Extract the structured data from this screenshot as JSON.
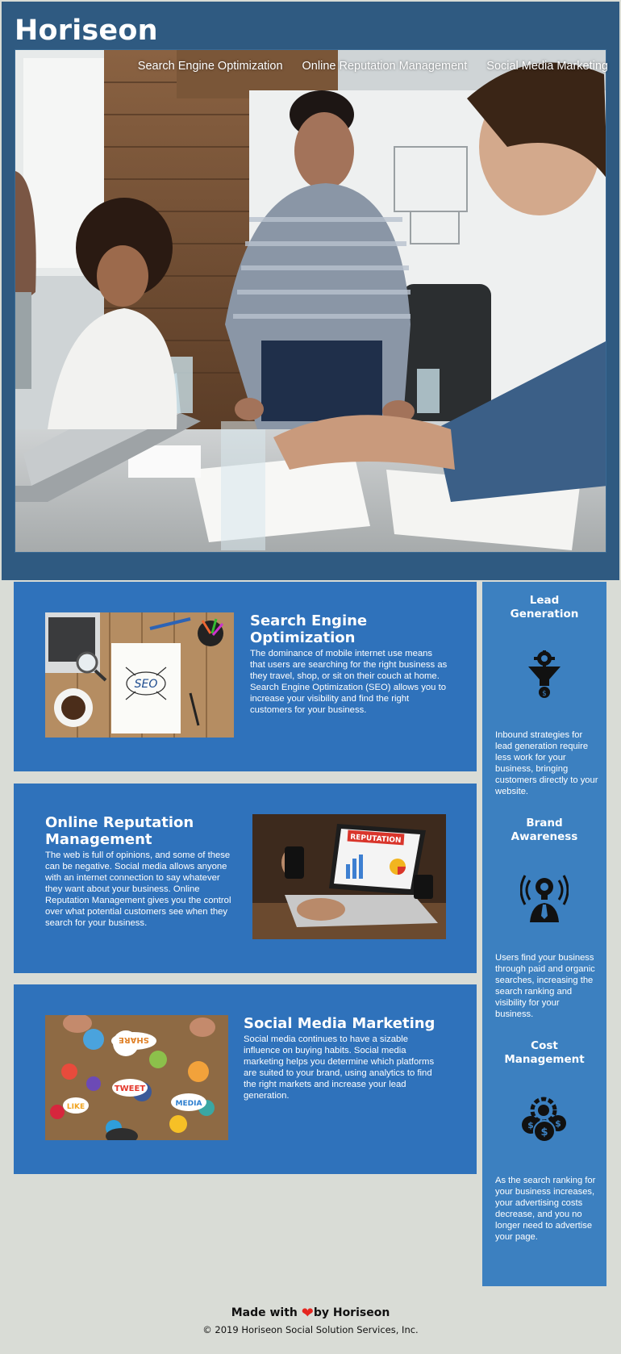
{
  "header": {
    "brand": "Horiseon",
    "nav": [
      {
        "label": "Search Engine Optimization"
      },
      {
        "label": "Online Reputation Management"
      },
      {
        "label": "Social Media Marketing"
      }
    ]
  },
  "hero": {
    "image": "team-meeting-photo"
  },
  "sections": [
    {
      "title": "Search Engine Optimization",
      "body": "The dominance of mobile internet use means that users are searching for the right business as they travel, shop, or sit on their couch at home. Search Engine Optimization (SEO) allows you to increase your visibility and find the right customers for your business.",
      "image": "seo-notebook-photo",
      "image_text": "SEO"
    },
    {
      "title": "Online Reputation Management",
      "body": "The web is full of opinions, and some of these can be negative. Social media allows anyone with an internet connection to say whatever they want about your business. Online Reputation Management gives you the control over what potential customers see when they search for your business.",
      "image": "laptop-reputation-photo",
      "image_text": "REPUTATION"
    },
    {
      "title": "Social Media Marketing",
      "body": "Social media continues to have a sizable influence on buying habits. Social media marketing helps you determine which platforms are suited to your brand, using analytics to find the right markets and increase your lead generation.",
      "image": "social-media-icons-photo",
      "image_text": [
        "SHARE",
        "TWEET",
        "LIKE",
        "MEDIA"
      ]
    }
  ],
  "sidebar": [
    {
      "title": "Lead Generation",
      "icon": "funnel-icon",
      "body": "Inbound strategies for lead generation require less work for your business, bringing customers directly to your website."
    },
    {
      "title": "Brand Awareness",
      "icon": "lightbulb-person-icon",
      "body": "Users find your business through paid and organic searches, increasing the search ranking and visibility for your business."
    },
    {
      "title": "Cost Management",
      "icon": "gear-dollar-icon",
      "body": "As the search ranking for your business increases, your advertising costs decrease, and you no longer need to advertise your page."
    }
  ],
  "footer": {
    "made_prefix": "Made with",
    "made_suffix": "by Horiseon",
    "copyright": "© 2019 Horiseon Social Solution Services, Inc."
  },
  "colors": {
    "header_bg": "#2f5a81",
    "card_bg": "#2f72bb",
    "sidebar_bg": "#3c80c0",
    "page_bg": "#d9dcd6",
    "heart": "#e52620"
  }
}
